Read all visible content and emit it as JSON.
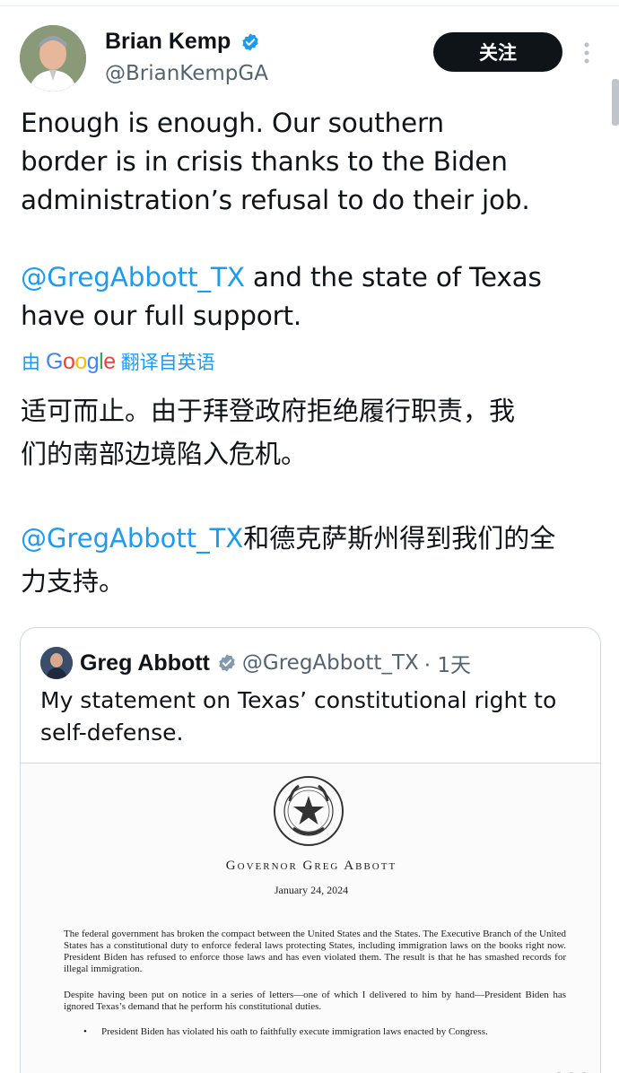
{
  "author": {
    "display_name": "Brian Kemp",
    "handle": "@BrianKempGA",
    "verified_icon": "verified-badge-icon",
    "follow_label": "关注",
    "more_icon": "more-vertical-icon"
  },
  "tweet": {
    "line1": "Enough is enough. Our southern",
    "line2": "border is in crisis thanks to the Biden",
    "line3": "administration’s refusal to do their job.",
    "mention": "@GregAbbott_TX",
    "line4_rest": " and the state of Texas",
    "line5": "have our full support."
  },
  "translation": {
    "prefix": "由",
    "brand": "Google",
    "suffix": "翻译自英语",
    "zh_line1": "适可而止。由于拜登政府拒绝履行职责，我",
    "zh_line2": "们的南部边境陷入危机。",
    "zh_mention": "@GregAbbott_TX",
    "zh_line3_rest": "和德克萨斯州得到我们的全",
    "zh_line4": "力支持。"
  },
  "quote": {
    "display_name": "Greg Abbott",
    "handle": "@GregAbbott_TX",
    "time": "· 1天",
    "text": "My statement on Texas’ constitutional right to self-defense.",
    "document": {
      "title": "Governor Greg Abbott",
      "date": "January 24, 2024",
      "para1": "The federal government has broken the compact between the United States and the States. The Executive Branch of the United States has a constitutional duty to enforce federal laws protecting States, including immigration laws on the books right now. President Biden has refused to enforce those laws and has even violated them. The result is that he has smashed records for illegal immigration.",
      "para2": "Despite having been put on notice in a series of letters—one of which I delivered to him by hand—President Biden has ignored Texas’s demand that he perform his constitutional duties.",
      "bullet1": "President Biden has violated his oath to faithfully execute immigration laws enacted by Congress."
    }
  },
  "colors": {
    "link": "#1d9bf0",
    "text": "#0f1419",
    "muted": "#536471",
    "follow_bg": "#0f1419"
  }
}
